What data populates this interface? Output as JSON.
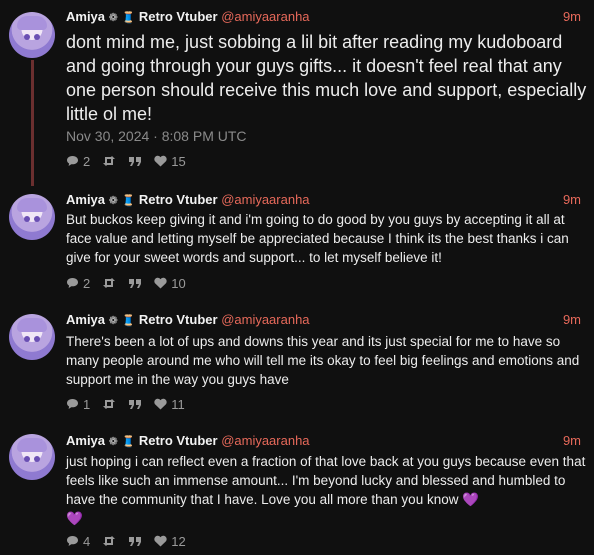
{
  "posts": [
    {
      "author": "Amiya",
      "badge_icons": [
        "gear-flower-icon",
        "spool-icon"
      ],
      "title": "Retro Vtuber",
      "handle": "@amiyaaranha",
      "time": "9m",
      "text": "dont mind me, just sobbing a lil bit after reading my kudoboard and going through your guys gifts... it doesn't feel real that any one person should receive this much love and support, especially little ol me!",
      "date": "Nov 30, 2024 · 8:08 PM UTC",
      "replies": "2",
      "likes": "15"
    },
    {
      "author": "Amiya",
      "title": "Retro Vtuber",
      "handle": "@amiyaaranha",
      "time": "9m",
      "text": "But buckos keep giving it and i'm going to do good by you guys by accepting it all at face value and letting myself be appreciated because I think its the best thanks i can give for your sweet words and support... to let myself believe it!",
      "replies": "2",
      "likes": "10"
    },
    {
      "author": "Amiya",
      "title": "Retro Vtuber",
      "handle": "@amiyaaranha",
      "time": "9m",
      "text": "There's been a lot of ups and downs this year and its just special for me to have so many people around me who will tell me its okay to feel big feelings and emotions and support me in the way you guys have",
      "replies": "1",
      "likes": "11"
    },
    {
      "author": "Amiya",
      "title": "Retro Vtuber",
      "handle": "@amiyaaranha",
      "time": "9m",
      "text": "just hoping i can reflect even a fraction of that love back at you guys because even that feels like such an immense amount... I'm beyond lucky and blessed and humbled to have the community that I have. Love you all more than you know",
      "emoji": "💜",
      "emoji2": "💜",
      "replies": "4",
      "likes": "12"
    }
  ],
  "colors": {
    "accent": "#e6695a",
    "background": "#101010",
    "thread": "#6b2f2f",
    "heart": "#9b6cff"
  }
}
